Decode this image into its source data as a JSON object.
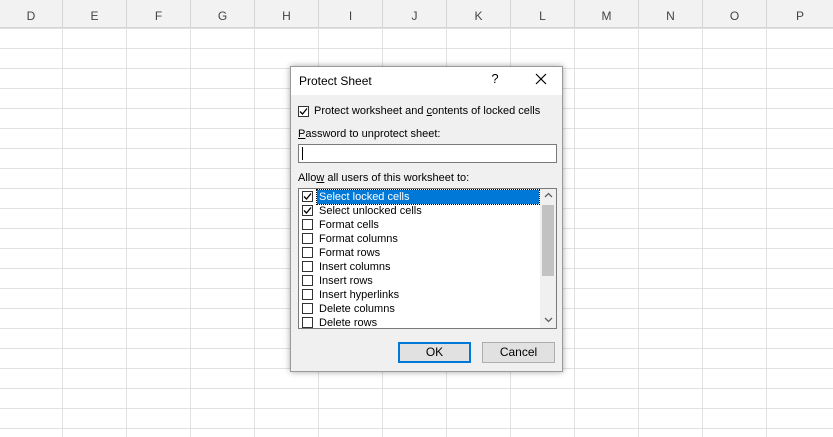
{
  "spreadsheet": {
    "columns": [
      "D",
      "E",
      "F",
      "G",
      "H",
      "I",
      "J",
      "K",
      "L",
      "M",
      "N",
      "O",
      "P"
    ]
  },
  "dialog": {
    "title": "Protect Sheet",
    "help_label": "?",
    "protect_option": {
      "label_pre": "Protect worksheet and ",
      "label_accel": "c",
      "label_post": "ontents of locked cells",
      "checked": true
    },
    "password": {
      "label_accel": "P",
      "label_rest": "assword to unprotect sheet:",
      "value": ""
    },
    "permissions": {
      "label_pre": "Allo",
      "label_accel": "w",
      "label_post": " all users of this worksheet to:",
      "items": [
        {
          "label": "Select locked cells",
          "checked": true,
          "selected": true
        },
        {
          "label": "Select unlocked cells",
          "checked": true,
          "selected": false
        },
        {
          "label": "Format cells",
          "checked": false,
          "selected": false
        },
        {
          "label": "Format columns",
          "checked": false,
          "selected": false
        },
        {
          "label": "Format rows",
          "checked": false,
          "selected": false
        },
        {
          "label": "Insert columns",
          "checked": false,
          "selected": false
        },
        {
          "label": "Insert rows",
          "checked": false,
          "selected": false
        },
        {
          "label": "Insert hyperlinks",
          "checked": false,
          "selected": false
        },
        {
          "label": "Delete columns",
          "checked": false,
          "selected": false
        },
        {
          "label": "Delete rows",
          "checked": false,
          "selected": false
        }
      ]
    },
    "buttons": {
      "ok": "OK",
      "cancel": "Cancel"
    }
  },
  "colors": {
    "selection": "#0078d7",
    "dialog_bg": "#f0f0f0",
    "header_bg": "#f2f2f2"
  }
}
